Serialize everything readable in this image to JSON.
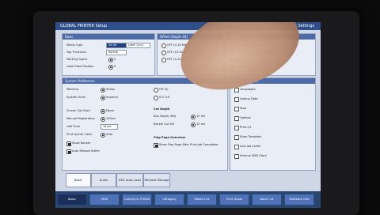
{
  "window": {
    "title": "GLOBAL PRINTER Setup",
    "right_label": "Printer Settings"
  },
  "panels": {
    "basic": {
      "title": "Basic",
      "fields": [
        {
          "label": "Media Type",
          "value": "Ink Jet",
          "value2": "Label 12×4"
        },
        {
          "label": "Tag Thickness",
          "value": "Normal"
        },
        {
          "label": "Marking Space",
          "value": "0"
        },
        {
          "label": "Label Feed Position",
          "value": "0"
        }
      ]
    },
    "offset": {
      "title": "Offset (Depth 40)",
      "options": [
        "OFF (0-10 Mil)",
        "OFF (10-50 Mil)",
        "OFF (4-10 Mil)"
      ]
    },
    "asf": {
      "title": "ASF/Bulk/Feed Mode",
      "options": [
        "Bulk ASF + Manual Feed",
        "Auto Detect Cartridge (with Printing)",
        "Disable",
        "Enabled"
      ]
    },
    "system": {
      "title": "System Preference",
      "fields": [
        {
          "label": "Warning",
          "value": "400µs"
        },
        {
          "label": "System Units",
          "value": "Imperial"
        },
        {
          "label": "Screen Lite Start",
          "value": "Never"
        },
        {
          "label": "Manual Registration",
          "value": "100ms"
        },
        {
          "label": "Half Time",
          "value": "10 sec"
        },
        {
          "label": "Print Queue Clean",
          "value": "Auto"
        }
      ],
      "right_options": [
        "Off (0)",
        "0.5 Cut"
      ],
      "checks": [
        "Show Banner",
        "Auto Restore Buffer"
      ]
    },
    "cut_depth": {
      "title": "Cut Depth",
      "fields": [
        {
          "label": "Kiss Depth (Mil)",
          "value": "10 mil"
        },
        {
          "label": "Backer Cut Mil",
          "value": "10 mil"
        }
      ]
    },
    "flag": {
      "title": "Flag Page Overview",
      "option": "Show Flag Page After Print Job Completes"
    },
    "memory": {
      "title": "Memory Protect",
      "items": [
        "Languages",
        "Lookup Data",
        "Stop",
        "Options",
        "Print Q1",
        "Store Template",
        "Last Job Cutter",
        "Internal MSD Store"
      ]
    }
  },
  "tabs": [
    {
      "label": "Basic"
    },
    {
      "label": "Audio"
    },
    {
      "label": "KSS Auto Load"
    },
    {
      "label": "Remote Manage"
    }
  ],
  "bottom_buttons": [
    {
      "label": "Basic"
    },
    {
      "label": "MSS"
    },
    {
      "label": "ColorSync Preset"
    },
    {
      "label": "Category"
    },
    {
      "label": "Media Cut"
    },
    {
      "label": "Print Spool"
    },
    {
      "label": "Back Cut"
    },
    {
      "label": "Software Info"
    }
  ]
}
